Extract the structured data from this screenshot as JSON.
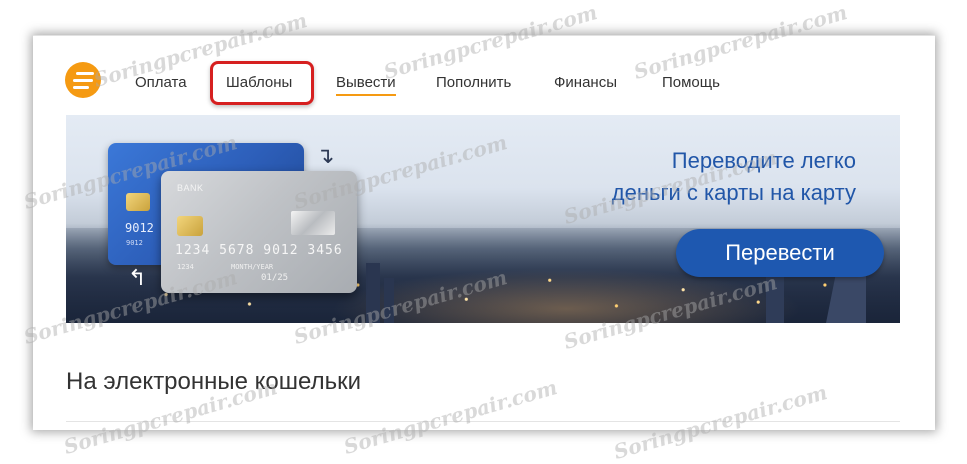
{
  "nav": {
    "items": [
      {
        "label": "Оплата"
      },
      {
        "label": "Шаблоны"
      },
      {
        "label": "Вывести"
      },
      {
        "label": "Пополнить"
      },
      {
        "label": "Финансы"
      },
      {
        "label": "Помощь"
      }
    ],
    "active_index": 2,
    "highlighted_index": 1
  },
  "banner": {
    "headline_line1": "Переводите легко",
    "headline_line2": "деньги с карты на карту",
    "button_label": "Перевести",
    "card_blue": {
      "number": "9012",
      "small": "9012"
    },
    "card_silver": {
      "bank": "BANK",
      "number": "1234 5678 9012 3456",
      "small": "1234",
      "expiry_label": "MONTH/YEAR",
      "expiry": "01/25"
    }
  },
  "section": {
    "title": "На электронные кошельки"
  },
  "watermark": {
    "text": "Soringpcrepair.com"
  },
  "colors": {
    "accent_orange": "#f59a12",
    "brand_blue": "#1e58b0",
    "highlight_red": "#d62020"
  },
  "icons": {
    "logo": "menu-hamburger-icon",
    "arrow_top": "curved-arrow-icon",
    "arrow_bottom": "curved-arrow-icon"
  }
}
